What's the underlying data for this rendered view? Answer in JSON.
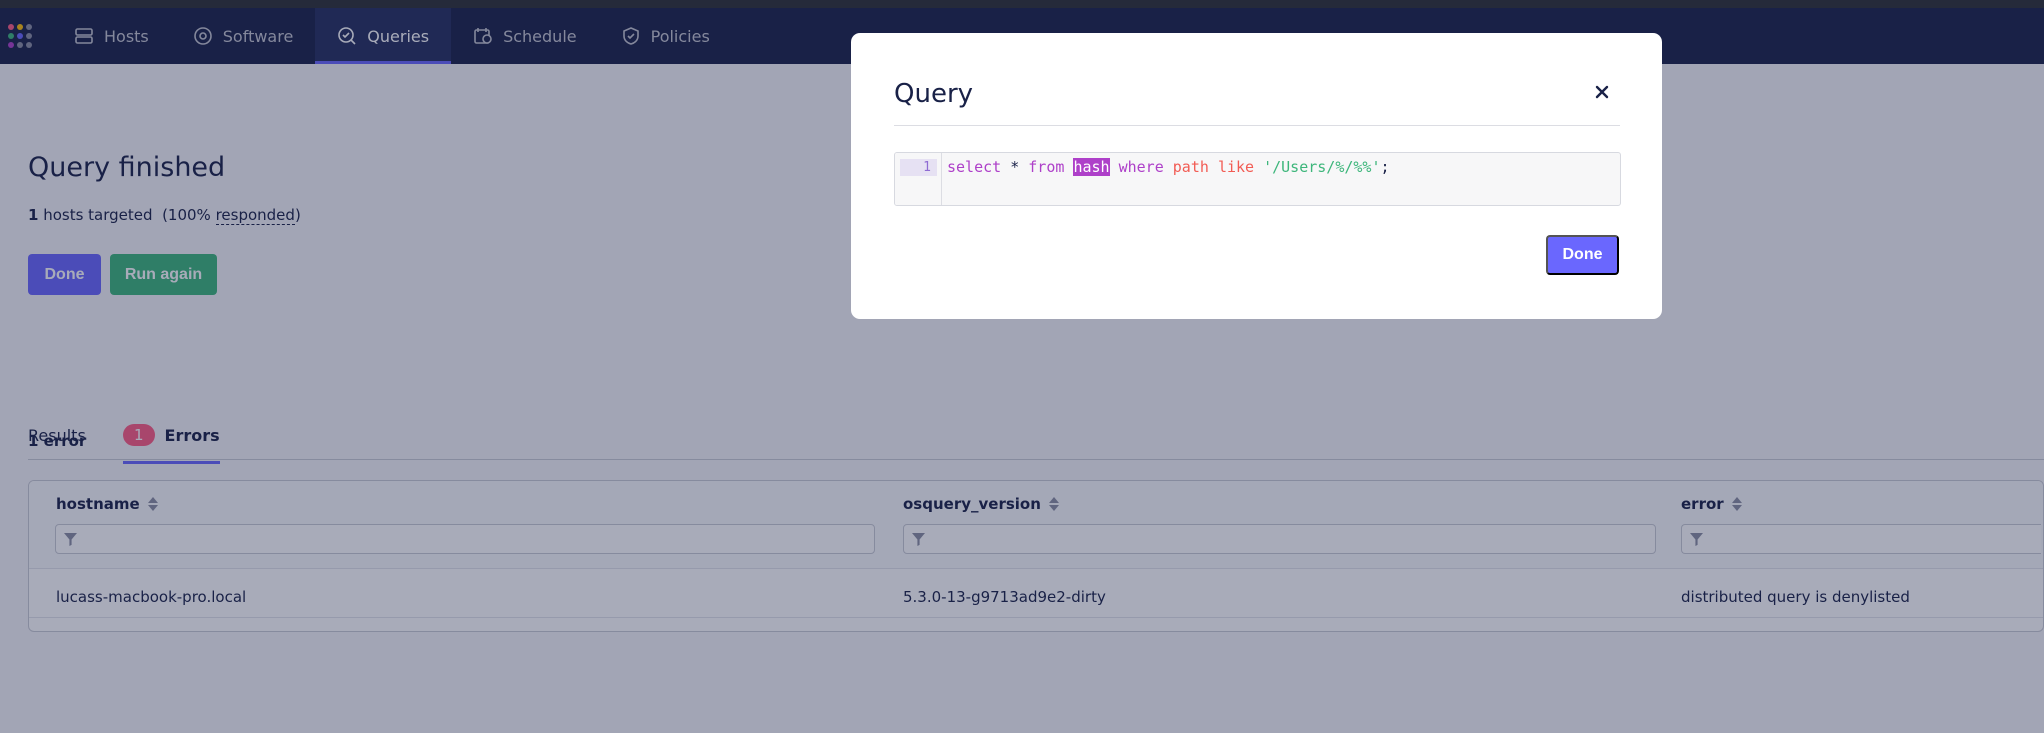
{
  "nav": {
    "items": [
      {
        "label": "Hosts",
        "icon": "hosts-icon"
      },
      {
        "label": "Software",
        "icon": "software-icon"
      },
      {
        "label": "Queries",
        "icon": "queries-icon"
      },
      {
        "label": "Schedule",
        "icon": "schedule-icon"
      },
      {
        "label": "Policies",
        "icon": "policies-icon"
      }
    ],
    "active": "Queries"
  },
  "page": {
    "title": "Query finished",
    "hosts_count": "1",
    "hosts_text": " hosts targeted  (100% ",
    "responded": "responded",
    "close_paren": ")",
    "done_button": "Done",
    "run_again_button": "Run again"
  },
  "tabs": {
    "results": "Results",
    "errors": "Errors",
    "errors_count": "1"
  },
  "errors_panel": {
    "summary": "1 error",
    "columns": [
      "hostname",
      "osquery_version",
      "error"
    ],
    "rows": [
      [
        "lucass-macbook-pro.local",
        "5.3.0-13-g9713ad9e2-dirty",
        "distributed query is denylisted"
      ]
    ]
  },
  "modal": {
    "title": "Query",
    "line_number": "1",
    "code_tokens": {
      "t1": "select",
      "t2": " * ",
      "t3": "from",
      "t4": " ",
      "t5": "hash",
      "t6": " ",
      "t7": "where",
      "t8": " ",
      "t9": "path",
      "t10": " ",
      "t11": "like",
      "t12": " ",
      "t13": "'/Users/%/%%'",
      "t14": ";"
    },
    "done_button": "Done"
  },
  "colors": {
    "navbar": "#192147",
    "accent": "#6a67fe",
    "success": "#3db67b",
    "error_badge": "#ff5c83"
  }
}
